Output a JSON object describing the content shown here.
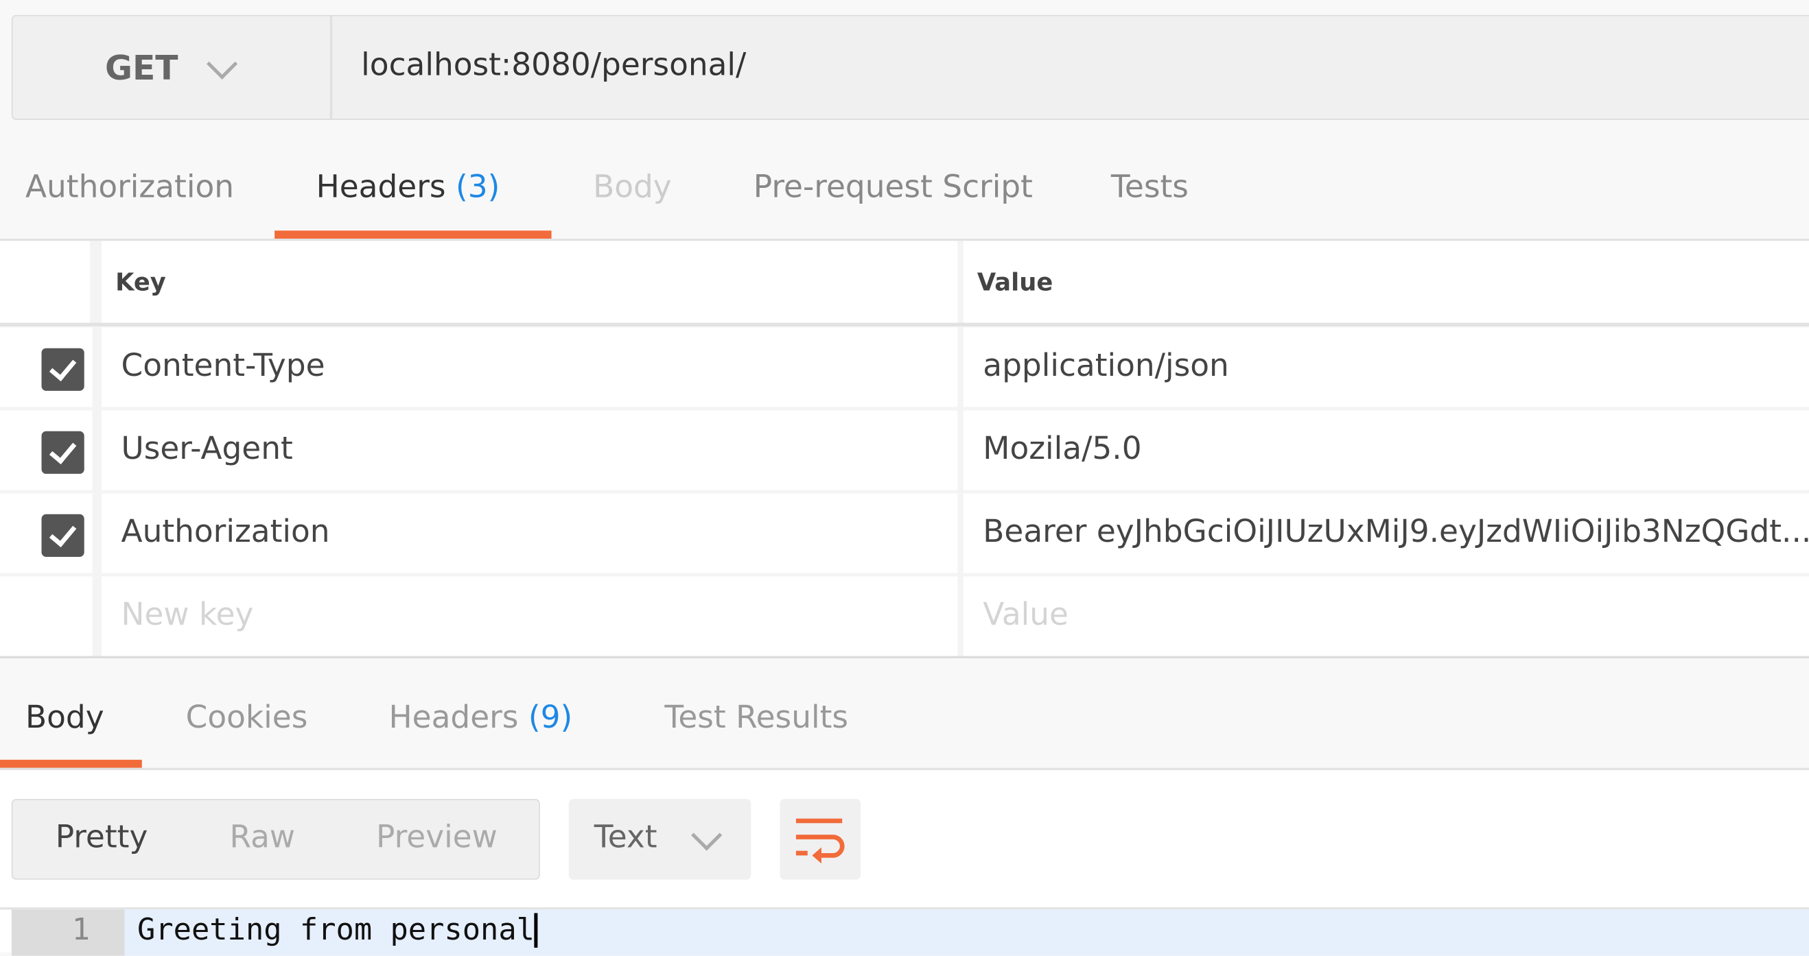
{
  "request": {
    "method": "GET",
    "url": "localhost:8080/personal/"
  },
  "request_tabs": [
    {
      "label": "Authorization",
      "count": ""
    },
    {
      "label": "Headers",
      "count": "(3)",
      "active": true
    },
    {
      "label": "Body",
      "count": "",
      "disabled": true
    },
    {
      "label": "Pre-request Script",
      "count": ""
    },
    {
      "label": "Tests",
      "count": ""
    }
  ],
  "headers_table": {
    "columns": {
      "key": "Key",
      "value": "Value"
    },
    "rows": [
      {
        "enabled": true,
        "key": "Content-Type",
        "value": "application/json"
      },
      {
        "enabled": true,
        "key": "User-Agent",
        "value": "Mozila/5.0"
      },
      {
        "enabled": true,
        "key": "Authorization",
        "value": "Bearer eyJhbGciOiJIUzUxMiJ9.eyJzdWIiOiJib3NzQGdt..."
      }
    ],
    "new_row": {
      "key_placeholder": "New key",
      "value_placeholder": "Value"
    }
  },
  "response_tabs": [
    {
      "label": "Body",
      "count": "",
      "active": true
    },
    {
      "label": "Cookies",
      "count": ""
    },
    {
      "label": "Headers",
      "count": "(9)"
    },
    {
      "label": "Test Results",
      "count": ""
    }
  ],
  "view_modes": [
    "Pretty",
    "Raw",
    "Preview"
  ],
  "active_view_mode": "Pretty",
  "format": "Text",
  "wrap_icon": "wrap-lines-icon",
  "response_body": [
    {
      "line": "1",
      "text": "Greeting from personal"
    }
  ],
  "colors": {
    "accent": "#f26b3a",
    "count": "#1e88e5"
  }
}
